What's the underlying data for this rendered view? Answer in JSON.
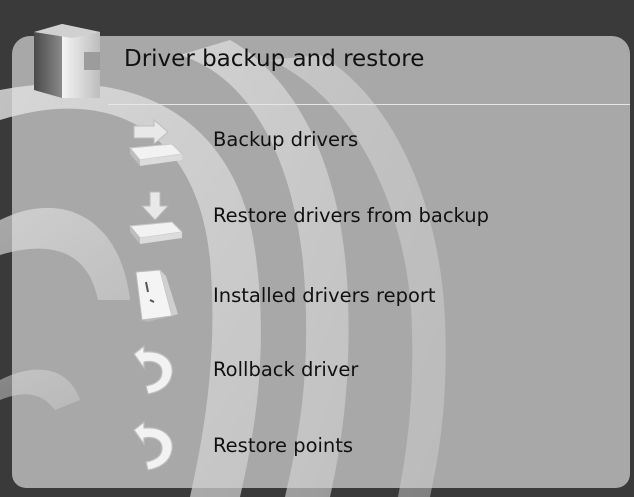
{
  "header": {
    "title": "Driver backup and restore",
    "icon": "driver-box-icon"
  },
  "menu": {
    "items": [
      {
        "label": "Backup drivers",
        "icon": "backup-drive-icon"
      },
      {
        "label": "Restore drivers from backup",
        "icon": "restore-drive-icon"
      },
      {
        "label": "Installed drivers report",
        "icon": "report-page-icon"
      },
      {
        "label": "Rollback driver",
        "icon": "rollback-arrow-icon"
      },
      {
        "label": "Restore points",
        "icon": "restore-arrow-icon"
      }
    ]
  },
  "colors": {
    "frame": "#3a3a3a",
    "panel": "#a8a8a8",
    "text": "#111111",
    "swoosh": "#d9d9d9"
  }
}
